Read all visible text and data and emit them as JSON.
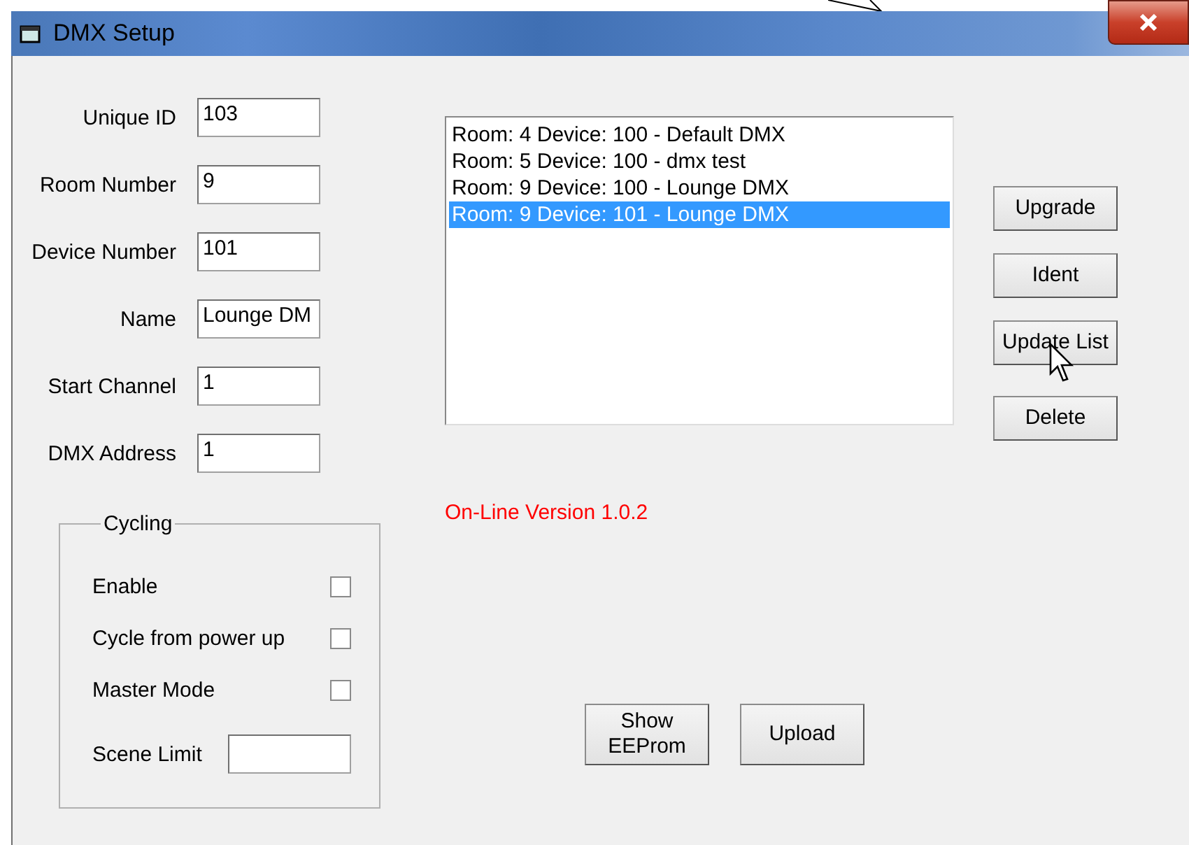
{
  "window": {
    "title": "DMX Setup"
  },
  "fields": [
    {
      "label": "Unique ID",
      "value": "103"
    },
    {
      "label": "Room Number",
      "value": "9"
    },
    {
      "label": "Device Number",
      "value": "101"
    },
    {
      "label": "Name",
      "value": "Lounge DM"
    },
    {
      "label": "Start Channel",
      "value": "1"
    },
    {
      "label": "DMX Address",
      "value": "1"
    }
  ],
  "cycling": {
    "title": "Cycling",
    "options": [
      {
        "label": "Enable",
        "checked": false
      },
      {
        "label": "Cycle from power up",
        "checked": false
      },
      {
        "label": "Master Mode",
        "checked": false
      }
    ],
    "scene_limit": {
      "label": "Scene Limit"
    }
  },
  "device_list": [
    {
      "text": "Room: 4 Device: 100 - Default DMX",
      "selected": false
    },
    {
      "text": "Room: 5 Device: 100 - dmx test",
      "selected": false
    },
    {
      "text": "Room: 9 Device: 100 - Lounge DMX",
      "selected": false
    },
    {
      "text": "Room: 9 Device: 101 - Lounge DMX",
      "selected": true
    }
  ],
  "status": "On-Line Version 1.0.2",
  "side_buttons": [
    "Upgrade",
    "Ident",
    "Update List",
    "Delete"
  ],
  "bottom_buttons": [
    "Show EEProm",
    "Upload"
  ]
}
